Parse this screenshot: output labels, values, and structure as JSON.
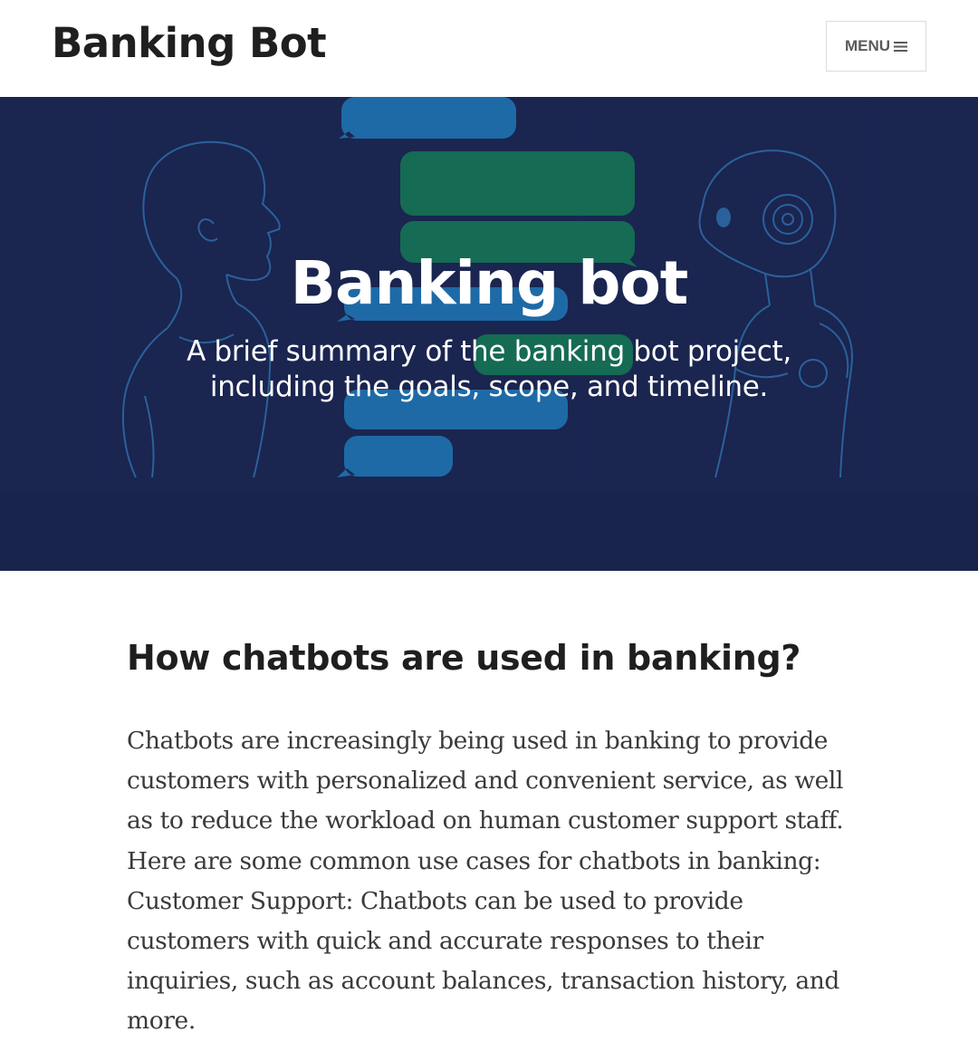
{
  "header": {
    "site_title": "Banking Bot",
    "menu_label": "MENU",
    "menu_icon": "hamburger-icon"
  },
  "hero": {
    "title": "Banking bot",
    "subtitle": "A brief summary of the banking bot project, including the goals, scope, and timeline.",
    "illustration": "human-and-robot-chat-illustration",
    "colors": {
      "background": "#1a2550",
      "line_art": "#2d6ca8",
      "bubble_blue": "#1e6aa6",
      "bubble_green": "#156b53"
    }
  },
  "content": {
    "heading": "How chatbots are used in banking?",
    "body": "Chatbots are increasingly being used in banking to provide customers with personalized and convenient service, as well as to reduce the workload on human customer support staff. Here are some common use cases for chatbots in banking: Customer Support: Chatbots can be used to provide customers with quick and accurate responses to their inquiries, such as account balances, transaction history, and more."
  }
}
